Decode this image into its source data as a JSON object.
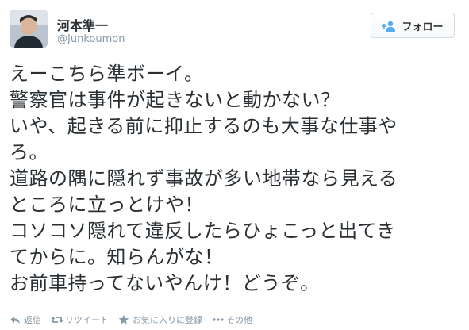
{
  "user": {
    "name": "河本準一",
    "handle": "@Junkoumon"
  },
  "follow_button": {
    "label": "フォロー"
  },
  "tweet": {
    "lines": [
      "えーこちら準ボーイ。",
      "警察官は事件が起きないと動かない？",
      "いや、起きる前に抑止するのも大事な仕事や",
      "ろ。",
      "道路の隅に隠れず事故が多い地帯なら見える",
      "ところに立っとけや！",
      "コソコソ隠れて違反したらひょこっと出てき",
      "てからに。知らんがな！",
      "お前車持ってないやんけ！どうぞ。"
    ]
  },
  "actions": {
    "reply": "返信",
    "retweet": "リツイート",
    "favorite": "お気に入りに登録",
    "more": "その他"
  },
  "colors": {
    "text": "#292f33",
    "muted": "#8899a6",
    "follow_icon": "#55acee"
  },
  "icons": {
    "follow": "add-user-icon",
    "reply": "reply-icon",
    "retweet": "retweet-icon",
    "favorite": "star-icon",
    "more": "more-dots-icon"
  }
}
